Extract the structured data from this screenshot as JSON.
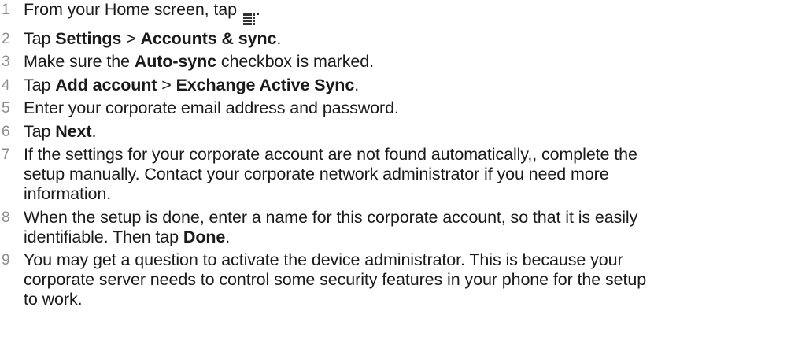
{
  "steps": [
    {
      "number": "1",
      "parts": [
        "From your Home screen, tap ",
        "."
      ],
      "icon": "apps-grid-icon"
    },
    {
      "number": "2",
      "parts": [
        "Tap ",
        "Settings",
        " > ",
        "Accounts & sync",
        "."
      ]
    },
    {
      "number": "3",
      "parts": [
        "Make sure the ",
        "Auto-sync",
        " checkbox is marked."
      ]
    },
    {
      "number": "4",
      "parts": [
        "Tap ",
        "Add account",
        " > ",
        "Exchange Active Sync",
        "."
      ]
    },
    {
      "number": "5",
      "text": "Enter your corporate email address and password."
    },
    {
      "number": "6",
      "parts": [
        "Tap ",
        "Next",
        "."
      ]
    },
    {
      "number": "7",
      "lines": [
        "If the settings for your corporate account are not found automatically,, complete the",
        "setup manually. Contact your corporate network administrator if you need more",
        "information."
      ]
    },
    {
      "number": "8",
      "lines": [
        "When the setup is done, enter a name for this corporate account, so that it is easily",
        "identifiable. Then tap "
      ],
      "bold": "Done",
      "tail": "."
    },
    {
      "number": "9",
      "lines": [
        "You may get a question to activate the device administrator. This is because your",
        "corporate server needs to control some security features in your phone for the setup",
        "to work."
      ]
    }
  ]
}
